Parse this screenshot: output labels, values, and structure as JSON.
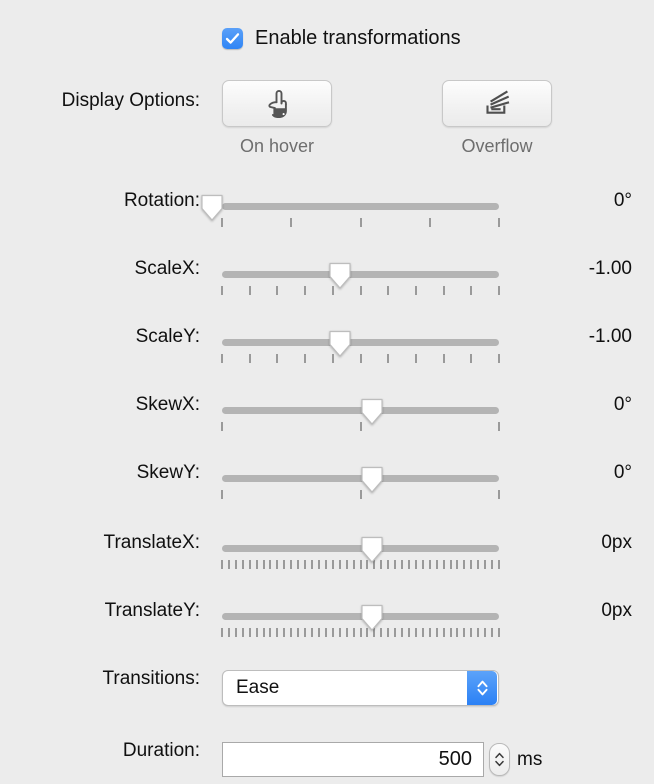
{
  "accent_color": "#2f85f5",
  "background_color": "#ececec",
  "enable": {
    "label": "Enable transformations",
    "checked": true,
    "icon": "checkmark-icon"
  },
  "display_options": {
    "label": "Display Options:",
    "buttons": [
      {
        "caption": "On hover",
        "icon": "pointing-hand-icon",
        "pressed": false
      },
      {
        "caption": "Overflow",
        "icon": "overflow-stack-icon",
        "pressed": false
      }
    ]
  },
  "sliders": [
    {
      "label": "Rotation:",
      "value_text": "0°",
      "thumb_percent": 0,
      "tick_count": 5,
      "unit": "°",
      "value": 0
    },
    {
      "label": "ScaleX:",
      "value_text": "-1.00",
      "thumb_percent": 40,
      "tick_count": 11,
      "unit": "",
      "value": -1.0
    },
    {
      "label": "ScaleY:",
      "value_text": "-1.00",
      "thumb_percent": 40,
      "tick_count": 11,
      "unit": "",
      "value": -1.0
    },
    {
      "label": "SkewX:",
      "value_text": "0°",
      "thumb_percent": 50,
      "tick_count": 3,
      "unit": "°",
      "value": 0
    },
    {
      "label": "SkewY:",
      "value_text": "0°",
      "thumb_percent": 50,
      "tick_count": 3,
      "unit": "°",
      "value": 0
    },
    {
      "label": "TranslateX:",
      "value_text": "0px",
      "thumb_percent": 50,
      "tick_count": 41,
      "unit": "px",
      "value": 0
    },
    {
      "label": "TranslateY:",
      "value_text": "0px",
      "thumb_percent": 50,
      "tick_count": 41,
      "unit": "px",
      "value": 0
    }
  ],
  "transitions": {
    "label": "Transitions:",
    "selected": "Ease",
    "icon": "chevron-updown-icon"
  },
  "duration": {
    "label": "Duration:",
    "value": "500",
    "unit": "ms",
    "icon": "stepper-updown-icon"
  }
}
